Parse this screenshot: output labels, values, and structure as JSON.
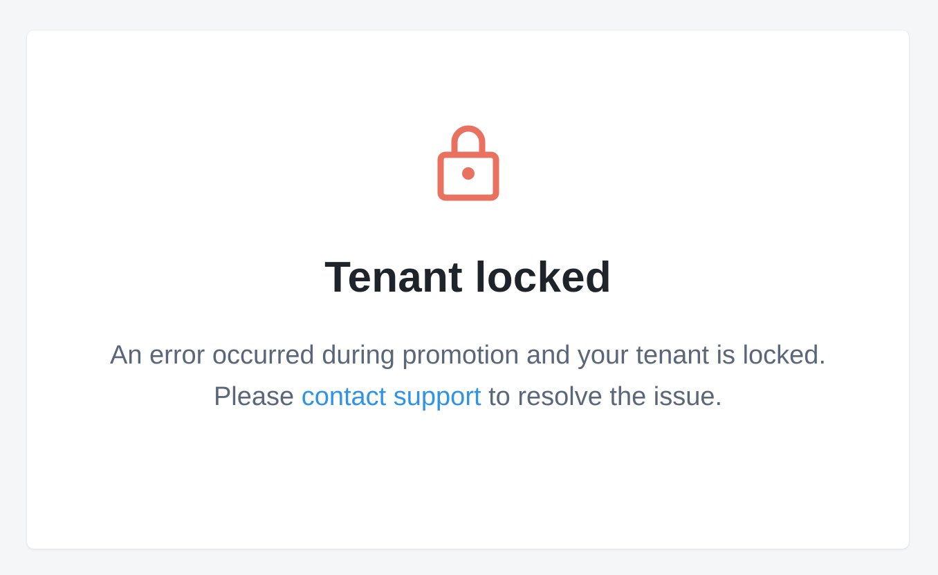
{
  "colors": {
    "background": "#f5f6f8",
    "card": "#ffffff",
    "icon": "#e8725f",
    "title": "#1f232a",
    "body_text": "#5a6679",
    "link": "#2f93e6"
  },
  "icon": "lock-icon",
  "title": "Tenant locked",
  "message": {
    "before_link": "An error occurred during promotion and your tenant is locked. Please ",
    "link_text": "contact support",
    "after_link": " to resolve the issue."
  }
}
